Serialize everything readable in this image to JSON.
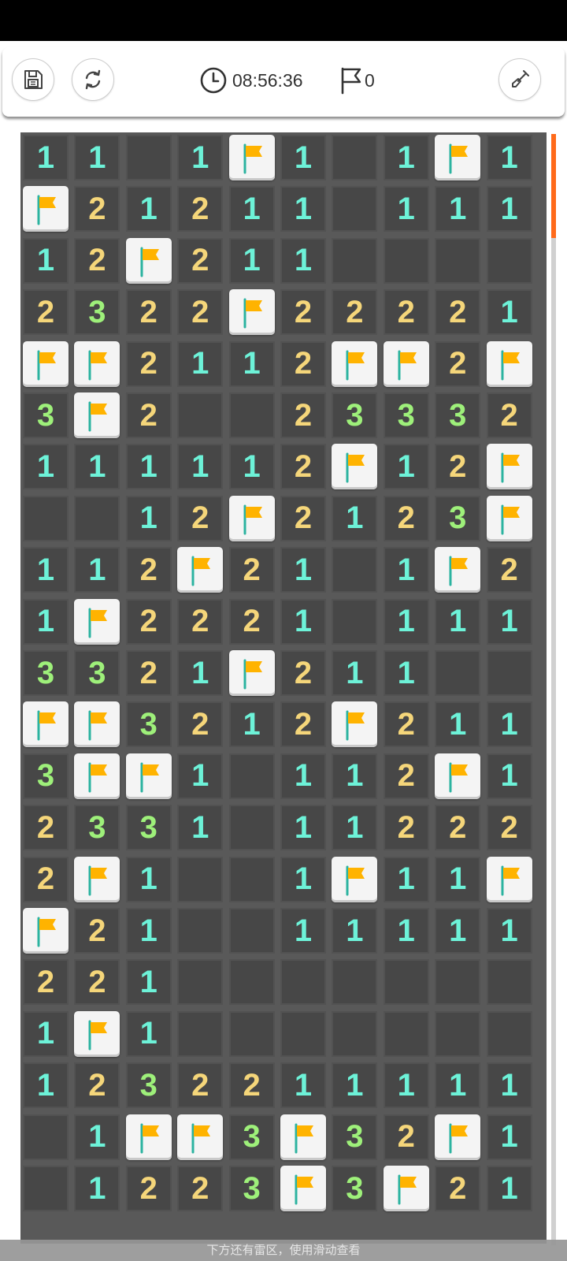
{
  "header": {
    "timer": "08:56:36",
    "flag_count": "0",
    "save_icon": "save-icon",
    "restart_icon": "restart-icon",
    "timer_icon": "clock-icon",
    "flag_icon": "flag-outline-icon",
    "tool_icon": "shovel-icon"
  },
  "board": {
    "columns": 10,
    "visible_rows": 21,
    "legend": "F = flagged cell, 0 = empty revealed cell, digit = adjacent mine count",
    "rows": [
      "110 1F1 1F1",
      "F21211 111",
      "12F211    ",
      "23 22F22221",
      "FF2112FF2F",
      "3F2  23332",
      "11111 2F12F",
      "  12F2123F",
      "112F21 1F2",
      "1F2221 111",
      "3321F211  ",
      "FF3212F211",
      "3FF1 112F1",
      "2331 11222",
      "2F1  1F11F",
      "F21  11111",
      "221       ",
      "1F1       ",
      "1232211111",
      " 1FF3F32F1",
      " 1223F3F21"
    ],
    "colors": {
      "n1": "#6df2d8",
      "n2": "#f5d67a",
      "n3": "#9ef07a",
      "flag": "#ffb300"
    }
  },
  "hint_text": "下方还有雷区，使用滑动查看"
}
